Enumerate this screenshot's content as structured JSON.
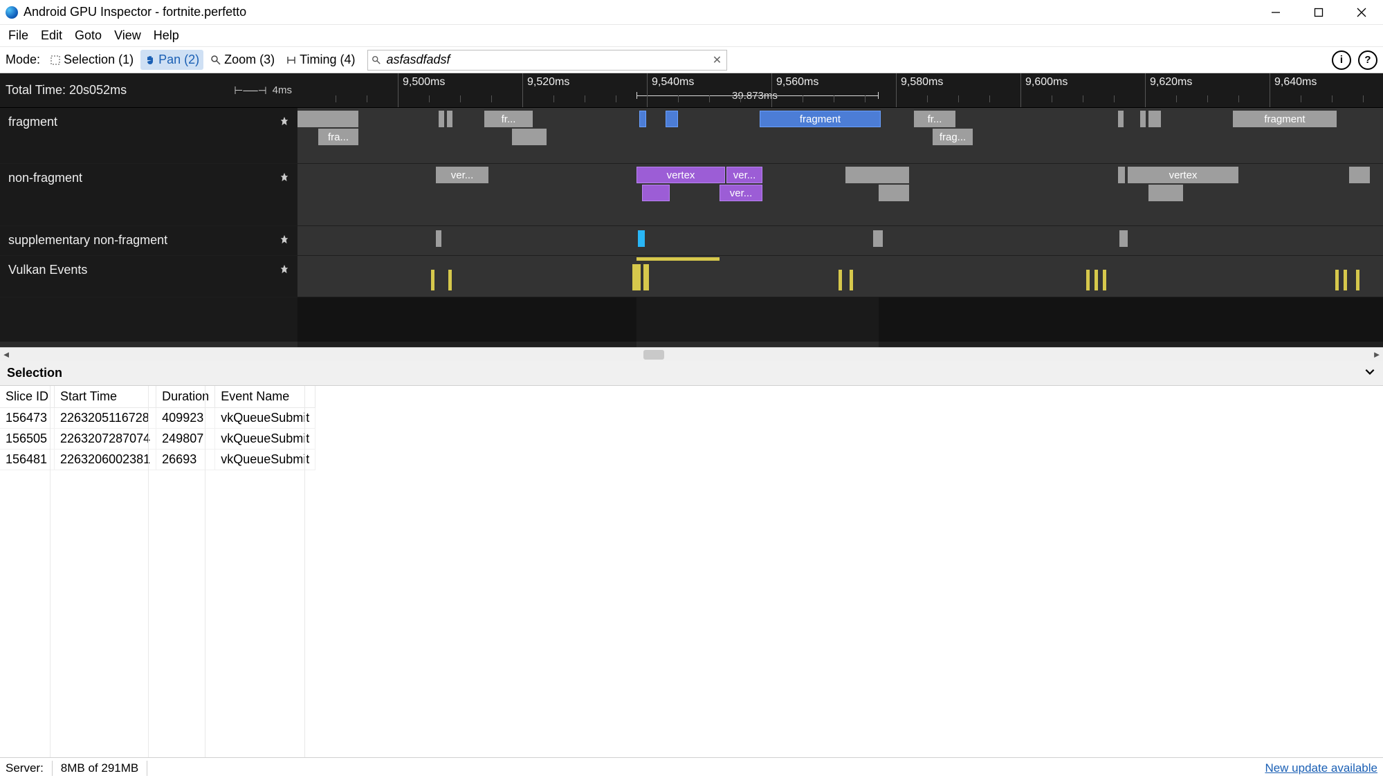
{
  "window": {
    "title": "Android GPU Inspector - fortnite.perfetto"
  },
  "menu": [
    "File",
    "Edit",
    "Goto",
    "View",
    "Help"
  ],
  "modebar": {
    "label": "Mode:",
    "modes": [
      {
        "label": "Selection (1)",
        "active": false
      },
      {
        "label": "Pan (2)",
        "active": true
      },
      {
        "label": "Zoom (3)",
        "active": false
      },
      {
        "label": "Timing (4)",
        "active": false
      }
    ],
    "search_value": "asfasdfadsf"
  },
  "timeline": {
    "total_time": "Total Time: 20s052ms",
    "zoom_step": "4ms",
    "ticks": [
      "9,500ms",
      "9,520ms",
      "9,540ms",
      "9,560ms",
      "9,580ms",
      "9,600ms",
      "9,620ms",
      "9,640ms"
    ],
    "range_label": "39.873ms",
    "tracks": [
      {
        "name": "fragment"
      },
      {
        "name": "non-fragment"
      },
      {
        "name": "supplementary non-fragment"
      },
      {
        "name": "Vulkan Events"
      }
    ],
    "slice_labels": {
      "fragment": "fragment",
      "fra": "fra...",
      "fr": "fr...",
      "frag": "frag...",
      "vertex": "vertex",
      "ver": "ver..."
    }
  },
  "selection": {
    "title": "Selection",
    "columns": [
      "Slice ID",
      "Start Time",
      "Duration",
      "Event Name"
    ],
    "rows": [
      {
        "c0": "156473",
        "c1": "2263205116728",
        "c2": "409923",
        "c3": "vkQueueSubmit"
      },
      {
        "c0": "156505",
        "c1": "2263207287074",
        "c2": "249807",
        "c3": "vkQueueSubmit"
      },
      {
        "c0": "156481",
        "c1": "2263206002381",
        "c2": "26693",
        "c3": "vkQueueSubmit"
      }
    ]
  },
  "status": {
    "server_label": "Server:",
    "mem": "8MB of 291MB",
    "update_link": "New update available"
  }
}
